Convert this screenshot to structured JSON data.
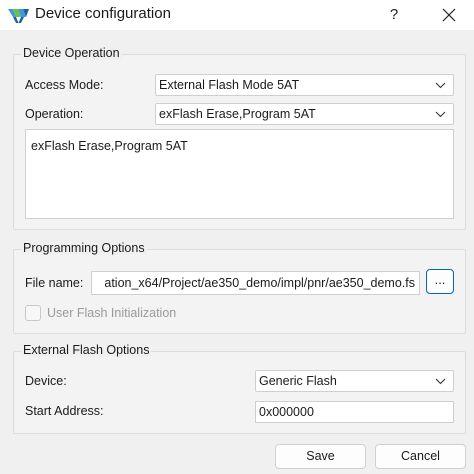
{
  "window": {
    "title": "Device configuration",
    "help_label": "?",
    "logo_colors": [
      "#3f9bd6",
      "#6cc04a",
      "#1f5fa8"
    ]
  },
  "device_operation": {
    "group_title": "Device Operation",
    "access_mode_label": "Access Mode:",
    "access_mode_value": "External Flash Mode 5AT",
    "operation_label": "Operation:",
    "operation_value": "exFlash Erase,Program 5AT",
    "description": "exFlash Erase,Program 5AT"
  },
  "programming_options": {
    "group_title": "Programming Options",
    "file_name_label": "File name:",
    "file_name_value": "ation_x64/Project/ae350_demo/impl/pnr/ae350_demo.fs",
    "browse_label": "...",
    "user_flash_label": "User Flash Initialization"
  },
  "external_flash_options": {
    "group_title": "External Flash Options",
    "device_label": "Device:",
    "device_value": "Generic Flash",
    "start_address_label": "Start Address:",
    "start_address_value": "0x000000"
  },
  "buttons": {
    "save": "Save",
    "cancel": "Cancel"
  }
}
